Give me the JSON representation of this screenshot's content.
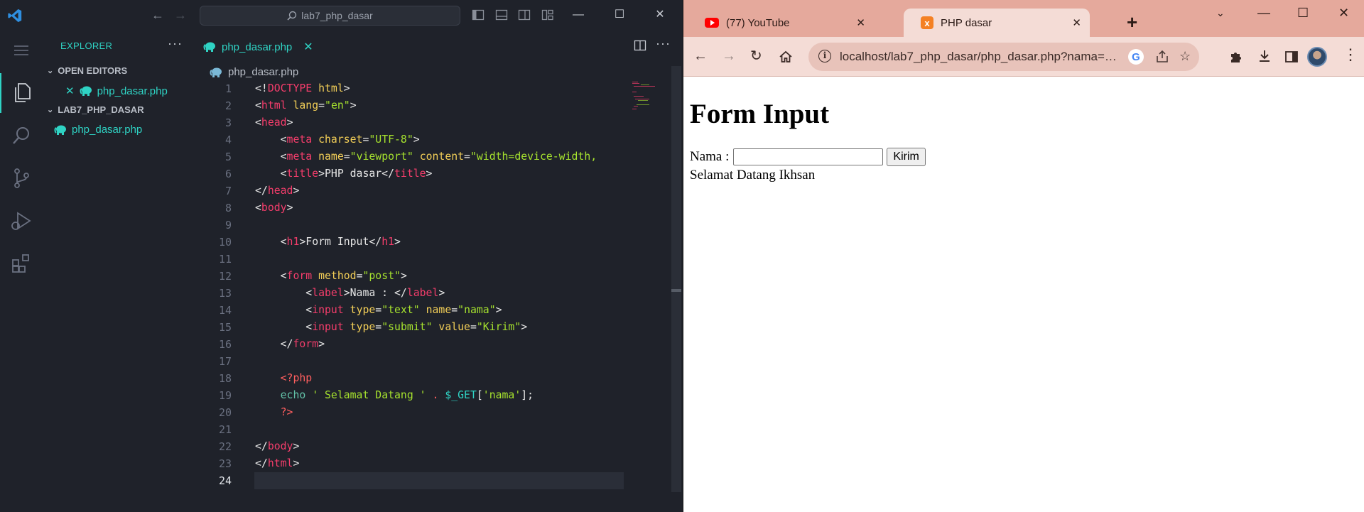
{
  "vscode": {
    "search_text": "lab7_php_dasar",
    "explorer_title": "EXPLORER",
    "sections": {
      "open_editors": "OPEN EDITORS",
      "project": "LAB7_PHP_DASAR"
    },
    "open_editor_file": "php_dasar.php",
    "project_file": "php_dasar.php",
    "tab_label": "php_dasar.php",
    "breadcrumb": "php_dasar.php",
    "accent": "#2fd3c4"
  },
  "code_lines": [
    [
      {
        "c": "p",
        "t": "<!"
      },
      {
        "c": "t",
        "t": "DOCTYPE"
      },
      {
        "c": "p",
        "t": " "
      },
      {
        "c": "a",
        "t": "html"
      },
      {
        "c": "p",
        "t": ">"
      }
    ],
    [
      {
        "c": "p",
        "t": "<"
      },
      {
        "c": "t",
        "t": "html"
      },
      {
        "c": "p",
        "t": " "
      },
      {
        "c": "a",
        "t": "lang"
      },
      {
        "c": "p",
        "t": "="
      },
      {
        "c": "s",
        "t": "\"en\""
      },
      {
        "c": "p",
        "t": ">"
      }
    ],
    [
      {
        "c": "p",
        "t": "<"
      },
      {
        "c": "t",
        "t": "head"
      },
      {
        "c": "p",
        "t": ">"
      }
    ],
    [
      {
        "c": "p",
        "t": "    <"
      },
      {
        "c": "t",
        "t": "meta"
      },
      {
        "c": "p",
        "t": " "
      },
      {
        "c": "a",
        "t": "charset"
      },
      {
        "c": "p",
        "t": "="
      },
      {
        "c": "s",
        "t": "\"UTF-8\""
      },
      {
        "c": "p",
        "t": ">"
      }
    ],
    [
      {
        "c": "p",
        "t": "    <"
      },
      {
        "c": "t",
        "t": "meta"
      },
      {
        "c": "p",
        "t": " "
      },
      {
        "c": "a",
        "t": "name"
      },
      {
        "c": "p",
        "t": "="
      },
      {
        "c": "s",
        "t": "\"viewport\""
      },
      {
        "c": "p",
        "t": " "
      },
      {
        "c": "a",
        "t": "content"
      },
      {
        "c": "p",
        "t": "="
      },
      {
        "c": "s",
        "t": "\"width=device-width,"
      }
    ],
    [
      {
        "c": "p",
        "t": "    <"
      },
      {
        "c": "t",
        "t": "title"
      },
      {
        "c": "p",
        "t": ">PHP dasar</"
      },
      {
        "c": "t",
        "t": "title"
      },
      {
        "c": "p",
        "t": ">"
      }
    ],
    [
      {
        "c": "p",
        "t": "</"
      },
      {
        "c": "t",
        "t": "head"
      },
      {
        "c": "p",
        "t": ">"
      }
    ],
    [
      {
        "c": "p",
        "t": "<"
      },
      {
        "c": "t",
        "t": "body"
      },
      {
        "c": "p",
        "t": ">"
      }
    ],
    [],
    [
      {
        "c": "p",
        "t": "    <"
      },
      {
        "c": "t",
        "t": "h1"
      },
      {
        "c": "p",
        "t": ">Form Input</"
      },
      {
        "c": "t",
        "t": "h1"
      },
      {
        "c": "p",
        "t": ">"
      }
    ],
    [],
    [
      {
        "c": "p",
        "t": "    <"
      },
      {
        "c": "t",
        "t": "form"
      },
      {
        "c": "p",
        "t": " "
      },
      {
        "c": "a",
        "t": "method"
      },
      {
        "c": "p",
        "t": "="
      },
      {
        "c": "s",
        "t": "\"post\""
      },
      {
        "c": "p",
        "t": ">"
      }
    ],
    [
      {
        "c": "p",
        "t": "        <"
      },
      {
        "c": "t",
        "t": "label"
      },
      {
        "c": "p",
        "t": ">Nama : </"
      },
      {
        "c": "t",
        "t": "label"
      },
      {
        "c": "p",
        "t": ">"
      }
    ],
    [
      {
        "c": "p",
        "t": "        <"
      },
      {
        "c": "t",
        "t": "input"
      },
      {
        "c": "p",
        "t": " "
      },
      {
        "c": "a",
        "t": "type"
      },
      {
        "c": "p",
        "t": "="
      },
      {
        "c": "s",
        "t": "\"text\""
      },
      {
        "c": "p",
        "t": " "
      },
      {
        "c": "a",
        "t": "name"
      },
      {
        "c": "p",
        "t": "="
      },
      {
        "c": "s",
        "t": "\"nama\""
      },
      {
        "c": "p",
        "t": ">"
      }
    ],
    [
      {
        "c": "p",
        "t": "        <"
      },
      {
        "c": "t",
        "t": "input"
      },
      {
        "c": "p",
        "t": " "
      },
      {
        "c": "a",
        "t": "type"
      },
      {
        "c": "p",
        "t": "="
      },
      {
        "c": "s",
        "t": "\"submit\""
      },
      {
        "c": "p",
        "t": " "
      },
      {
        "c": "a",
        "t": "value"
      },
      {
        "c": "p",
        "t": "="
      },
      {
        "c": "s",
        "t": "\"Kirim\""
      },
      {
        "c": "p",
        "t": ">"
      }
    ],
    [
      {
        "c": "p",
        "t": "    </"
      },
      {
        "c": "t",
        "t": "form"
      },
      {
        "c": "p",
        "t": ">"
      }
    ],
    [],
    [
      {
        "c": "p",
        "t": "    "
      },
      {
        "c": "ph",
        "t": "<?php"
      }
    ],
    [
      {
        "c": "p",
        "t": "    "
      },
      {
        "c": "sf",
        "t": "echo"
      },
      {
        "c": "p",
        "t": " "
      },
      {
        "c": "s",
        "t": "' Selamat Datang '"
      },
      {
        "c": "p",
        "t": " "
      },
      {
        "c": "ph",
        "t": "."
      },
      {
        "c": "p",
        "t": " "
      },
      {
        "c": "v",
        "t": "$_GET"
      },
      {
        "c": "p",
        "t": "["
      },
      {
        "c": "s",
        "t": "'nama'"
      },
      {
        "c": "p",
        "t": "];"
      }
    ],
    [
      {
        "c": "p",
        "t": "    "
      },
      {
        "c": "ph",
        "t": "?>"
      }
    ],
    [],
    [
      {
        "c": "p",
        "t": "</"
      },
      {
        "c": "t",
        "t": "body"
      },
      {
        "c": "p",
        "t": ">"
      }
    ],
    [
      {
        "c": "p",
        "t": "</"
      },
      {
        "c": "t",
        "t": "html"
      },
      {
        "c": "p",
        "t": ">"
      }
    ],
    []
  ],
  "current_line": 24,
  "chrome": {
    "tabs": [
      {
        "title": "(77) YouTube",
        "icon": "youtube-icon",
        "active": false
      },
      {
        "title": "PHP dasar",
        "icon": "xampp-icon",
        "active": true
      }
    ],
    "url": "localhost/lab7_php_dasar/php_dasar.php?nama=I...",
    "tabstrip_color": "#e5a99c",
    "toolbar_color": "#f4dcd6"
  },
  "webpage": {
    "heading": "Form Input",
    "label": "Nama :",
    "input_value": "",
    "submit_label": "Kirim",
    "greeting": "Selamat Datang Ikhsan"
  }
}
